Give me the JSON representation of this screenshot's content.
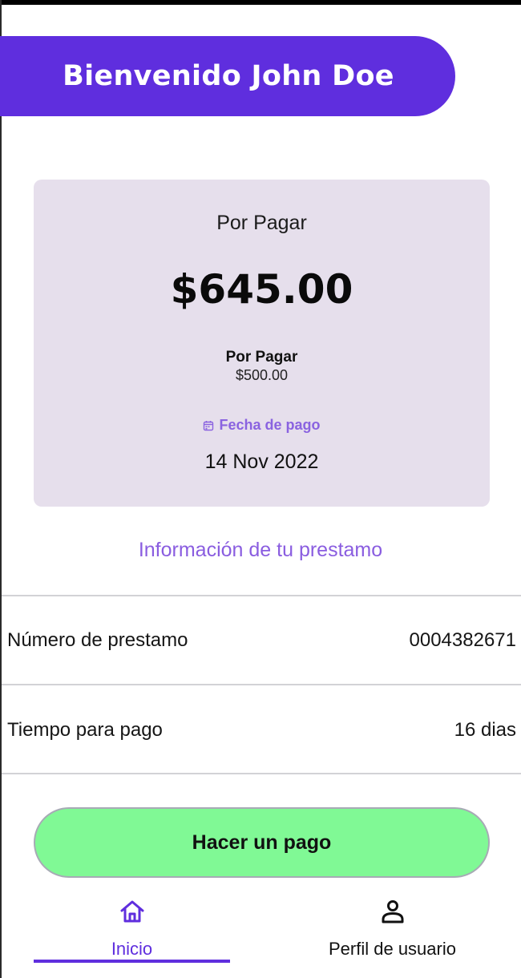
{
  "colors": {
    "accent": "#5f2ede",
    "accent_light": "#8a5de0",
    "card_background": "#e6dfec",
    "pay_button": "#80f995"
  },
  "header": {
    "title": "Bienvenido John Doe"
  },
  "summary_card": {
    "title": "Por Pagar",
    "amount": "$645.00",
    "sub_title": "Por Pagar",
    "sub_amount": "$500.00",
    "date_icon": "calendar-icon",
    "date_label": "Fecha de pago",
    "date_value": "14 Nov 2022"
  },
  "loan_info": {
    "link_label": "Información de tu prestamo",
    "rows": [
      {
        "label": "Número de prestamo",
        "value": "0004382671"
      },
      {
        "label": "Tiempo para pago",
        "value": "16 dias"
      }
    ]
  },
  "actions": {
    "pay_label": "Hacer un pago"
  },
  "bottom_nav": {
    "items": [
      {
        "label": "Inicio",
        "icon": "home-icon",
        "active": true
      },
      {
        "label": "Perfil de usuario",
        "icon": "user-icon",
        "active": false
      }
    ]
  }
}
